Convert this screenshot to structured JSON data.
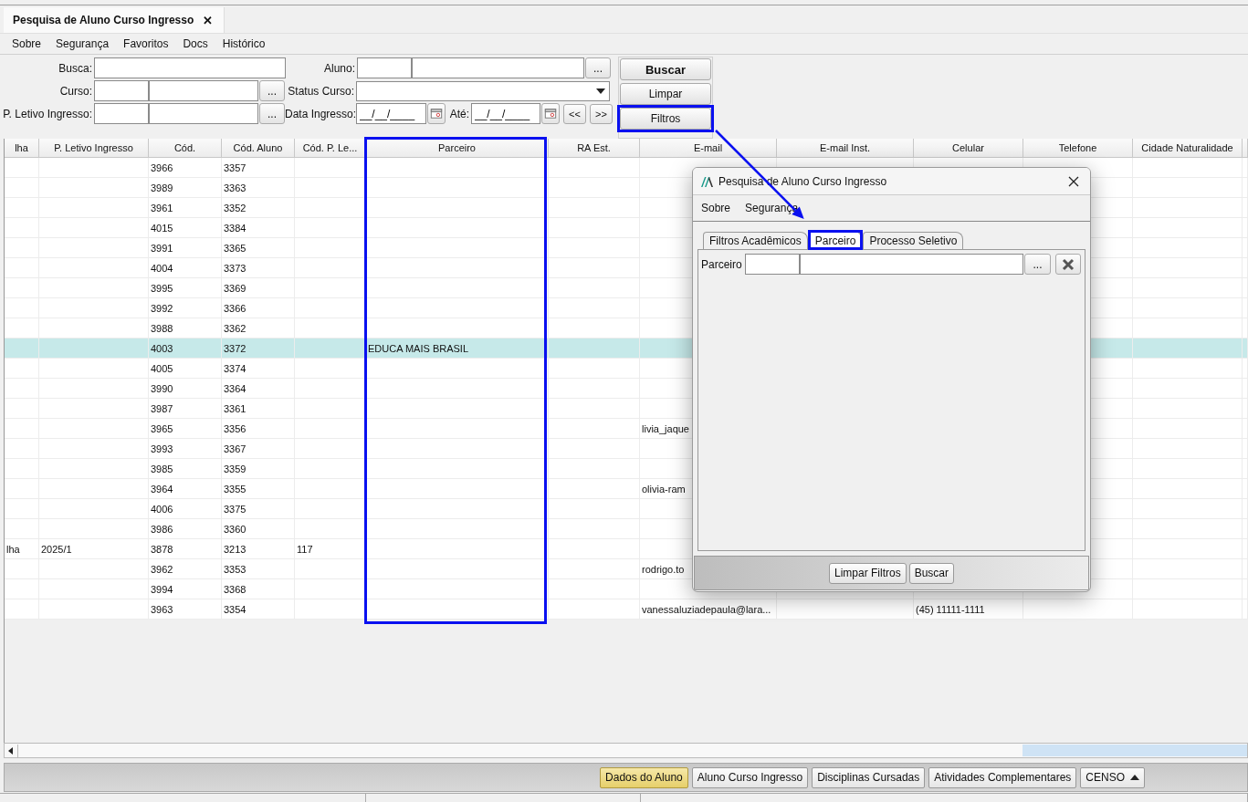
{
  "main_tab": {
    "title": "Pesquisa de Aluno Curso Ingresso",
    "close": "✕"
  },
  "menu": [
    "Sobre",
    "Segurança",
    "Favoritos",
    "Docs",
    "Histórico"
  ],
  "search_form": {
    "busca": {
      "label": "Busca:"
    },
    "aluno": {
      "label": "Aluno:",
      "button": "..."
    },
    "curso": {
      "label": "Curso:",
      "button": "..."
    },
    "status_curso": {
      "label": "Status Curso:"
    },
    "p_letivo_ingresso": {
      "label": "P. Letivo Ingresso:",
      "button": "..."
    },
    "data_ingresso": {
      "label": "Data Ingresso:",
      "value": "__/__/____"
    },
    "ate": {
      "label": "Até:",
      "value": "__/__/____"
    },
    "prev_button": "<<",
    "next_button": ">>"
  },
  "action_buttons": [
    {
      "label": "Buscar",
      "kind": "primary",
      "highlighted": false
    },
    {
      "label": "Limpar",
      "kind": "normal",
      "highlighted": false
    },
    {
      "label": "Filtros",
      "kind": "normal",
      "highlighted": true
    }
  ],
  "table": {
    "columns": [
      {
        "label": "lha",
        "highlighted": false
      },
      {
        "label": "P. Letivo Ingresso",
        "highlighted": false
      },
      {
        "label": "Cód.",
        "highlighted": false
      },
      {
        "label": "Cód. Aluno",
        "highlighted": false
      },
      {
        "label": "Cód. P. Le...",
        "highlighted": false
      },
      {
        "label": "Parceiro",
        "highlighted": true
      },
      {
        "label": "RA Est.",
        "highlighted": false
      },
      {
        "label": "E-mail",
        "highlighted": false
      },
      {
        "label": "E-mail Inst.",
        "highlighted": false
      },
      {
        "label": "Celular",
        "highlighted": false
      },
      {
        "label": "Telefone",
        "highlighted": false
      },
      {
        "label": "Cidade Naturalidade",
        "highlighted": false
      }
    ],
    "rows": [
      {
        "cod": "3966",
        "cod_aluno": "3357",
        "selected": false
      },
      {
        "cod": "3989",
        "cod_aluno": "3363",
        "selected": false
      },
      {
        "cod": "3961",
        "cod_aluno": "3352",
        "selected": false
      },
      {
        "cod": "4015",
        "cod_aluno": "3384",
        "selected": false
      },
      {
        "cod": "3991",
        "cod_aluno": "3365",
        "selected": false
      },
      {
        "cod": "4004",
        "cod_aluno": "3373",
        "selected": false
      },
      {
        "cod": "3995",
        "cod_aluno": "3369",
        "selected": false
      },
      {
        "cod": "3992",
        "cod_aluno": "3366",
        "selected": false
      },
      {
        "cod": "3988",
        "cod_aluno": "3362",
        "selected": false
      },
      {
        "cod": "4003",
        "cod_aluno": "3372",
        "parceiro": "EDUCA MAIS BRASIL",
        "selected": true
      },
      {
        "cod": "4005",
        "cod_aluno": "3374",
        "selected": false
      },
      {
        "cod": "3990",
        "cod_aluno": "3364",
        "selected": false
      },
      {
        "cod": "3987",
        "cod_aluno": "3361",
        "selected": false
      },
      {
        "cod": "3965",
        "cod_aluno": "3356",
        "email": "livia_jaque",
        "selected": false
      },
      {
        "cod": "3993",
        "cod_aluno": "3367",
        "selected": false
      },
      {
        "cod": "3985",
        "cod_aluno": "3359",
        "selected": false
      },
      {
        "cod": "3964",
        "cod_aluno": "3355",
        "email": "olivia-ram",
        "selected": false
      },
      {
        "cod": "4006",
        "cod_aluno": "3375",
        "selected": false
      },
      {
        "cod": "3986",
        "cod_aluno": "3360",
        "selected": false
      },
      {
        "column_1": "lha",
        "p_letivo_ingresso": "2025/1",
        "cod": "3878",
        "cod_aluno": "3213",
        "cod_p_le": "117",
        "selected": false
      },
      {
        "cod": "3962",
        "cod_aluno": "3353",
        "email": "rodrigo.to",
        "selected": false
      },
      {
        "cod": "3994",
        "cod_aluno": "3368",
        "selected": false
      },
      {
        "cod": "3963",
        "cod_aluno": "3354",
        "email": "vanessaluziadepaula@lara...",
        "celular": "(45) 11111-1111",
        "selected": false
      }
    ]
  },
  "bottom_bar": {
    "buttons": [
      {
        "label": "Dados do Aluno",
        "selected": true,
        "kind": "plain"
      },
      {
        "label": "Aluno Curso Ingresso",
        "selected": false,
        "kind": "plain"
      },
      {
        "label": "Disciplinas Cursadas",
        "selected": false,
        "kind": "plain"
      },
      {
        "label": "Atividades Complementares",
        "selected": false,
        "kind": "plain"
      },
      {
        "label": "CENSO",
        "selected": false,
        "kind": "dropdown"
      }
    ]
  },
  "dialog": {
    "title": "Pesquisa de Aluno Curso Ingresso",
    "menu": [
      "Sobre",
      "Segurança"
    ],
    "tabs": [
      {
        "label": "Filtros Acadêmicos",
        "selected": false,
        "highlighted": false
      },
      {
        "label": "Parceiro",
        "selected": true,
        "highlighted": true
      },
      {
        "label": "Processo Seletivo",
        "selected": false,
        "highlighted": false
      }
    ],
    "parceiro_field": {
      "label": "Parceiro",
      "button": "..."
    },
    "footer_buttons": [
      "Limpar Filtros",
      "Buscar"
    ]
  },
  "annotations": [
    {
      "kind": "arrow"
    }
  ]
}
